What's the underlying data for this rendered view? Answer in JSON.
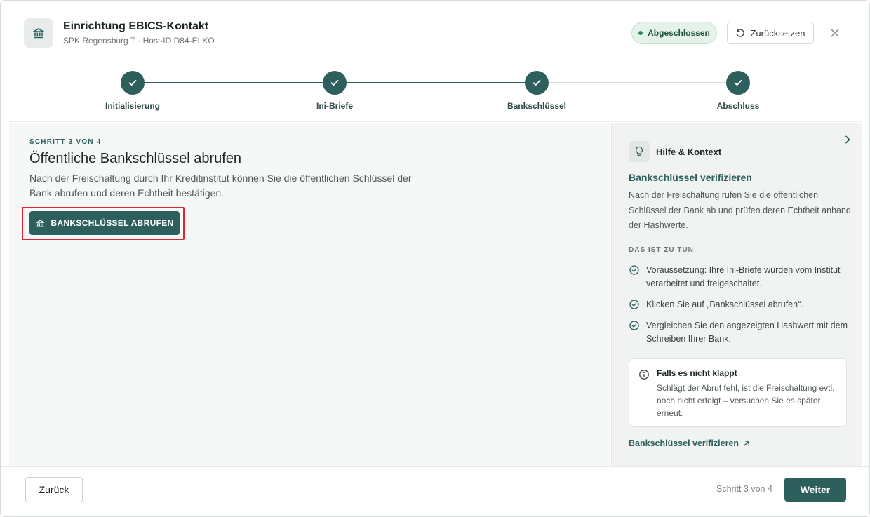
{
  "header": {
    "title": "Einrichtung EBICS-Kontakt",
    "subtitle": "SPK Regensburg T · Host-ID D84-ELKO",
    "status_badge": "Abgeschlossen",
    "reset_label": "Zurücksetzen",
    "icons": {
      "app": "bank-icon",
      "reset": "refresh-icon",
      "close": "close-icon"
    }
  },
  "stepper": {
    "steps": [
      {
        "label": "Initialisierung",
        "state": "done"
      },
      {
        "label": "Ini-Briefe",
        "state": "done"
      },
      {
        "label": "Bankschlüssel",
        "state": "done"
      },
      {
        "label": "Abschluss",
        "state": "done"
      }
    ]
  },
  "main": {
    "kicker": "SCHRITT 3 VON 4",
    "title": "Öffentliche Bankschlüssel abrufen",
    "description": "Nach der Freischaltung durch Ihr Kreditinstitut können Sie die öffentlichen Schlüssel der Bank abrufen und deren Echtheit bestätigen.",
    "action_label": "BANKSCHLÜSSEL ABRUFEN"
  },
  "side": {
    "heading": "Hilfe & Kontext",
    "subtitle": "Bankschlüssel verifizieren",
    "description": "Nach der Freischaltung rufen Sie die öffentlichen Schlüssel der Bank ab und prüfen deren Echtheit anhand der Hashwerte.",
    "todo_title": "DAS IST ZU TUN",
    "todo_items": [
      "Voraussetzung: Ihre Ini-Briefe wurden vom Institut verarbeitet und freigeschaltet.",
      "Klicken Sie auf „Bankschlüssel abrufen“.",
      "Vergleichen Sie den angezeigten Hashwert mit dem Schreiben Ihrer Bank."
    ],
    "note": {
      "title": "Falls es nicht klappt",
      "text": "Schlägt der Abruf fehl, ist die Freischaltung evtl. noch nicht erfolgt – versuchen Sie es später erneut."
    },
    "link_label": "Bankschlüssel verifizieren"
  },
  "footer": {
    "back_label": "Zurück",
    "progress": "Schritt 3 von 4",
    "next_label": "Weiter"
  },
  "colors": {
    "primary": "#2d5f5d",
    "success_bg": "#e4f2ea",
    "success_dot": "#2f8a5c",
    "highlight": "#e3232c"
  }
}
